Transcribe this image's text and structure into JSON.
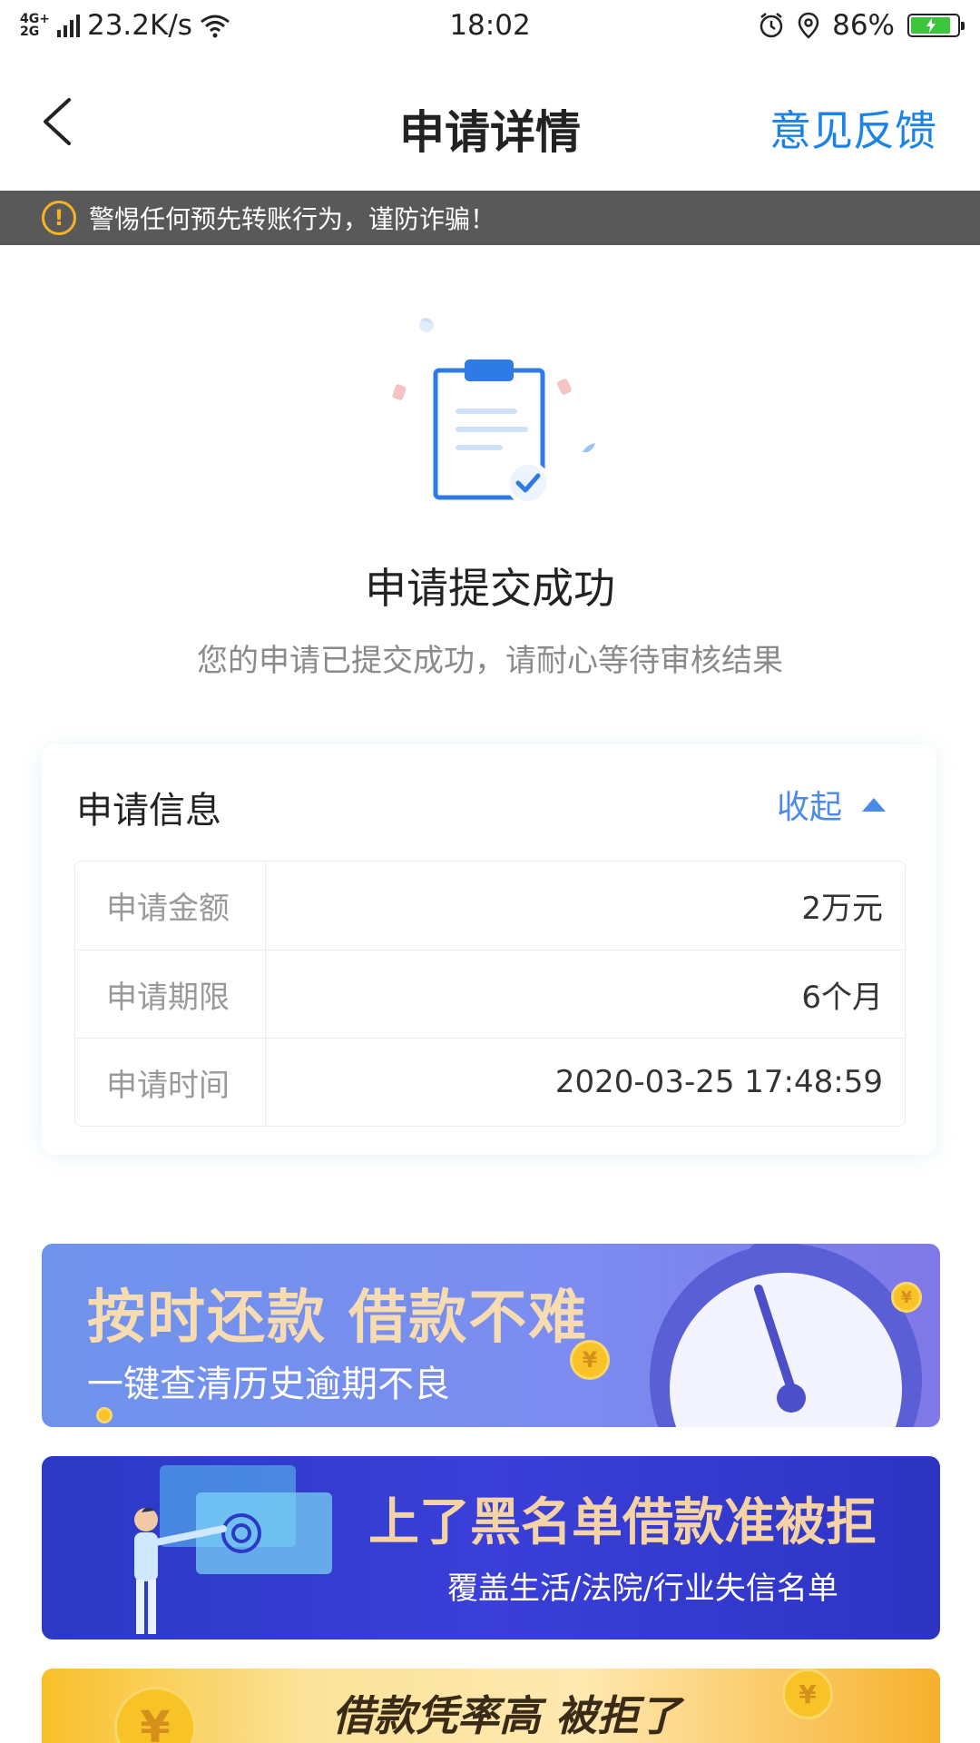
{
  "status_bar": {
    "network_top": "4G+",
    "network_bottom": "2G",
    "speed": "23.2K/s",
    "time": "18:02",
    "battery": "86%"
  },
  "nav": {
    "title": "申请详情",
    "feedback": "意见反馈"
  },
  "warning": {
    "text": "警惕任何预先转账行为，谨防诈骗！",
    "icon_glyph": "!"
  },
  "success": {
    "title": "申请提交成功",
    "subtitle": "您的申请已提交成功，请耐心等待审核结果"
  },
  "info_card": {
    "title": "申请信息",
    "collapse_label": "收起",
    "rows": [
      {
        "label": "申请金额",
        "value": "2万元"
      },
      {
        "label": "申请期限",
        "value": "6个月"
      },
      {
        "label": "申请时间",
        "value": "2020-03-25 17:48:59"
      }
    ]
  },
  "banners": [
    {
      "title": "按时还款 借款不难",
      "subtitle": "一键查清历史逾期不良"
    },
    {
      "title": "上了黑名单借款准被拒",
      "subtitle": "覆盖生活/法院/行业失信名单"
    },
    {
      "title": "借款凭率高 被拒了"
    }
  ],
  "colors": {
    "accent_blue": "#1a82e8",
    "warning_bg": "#595959",
    "warning_icon": "#f5b324"
  }
}
